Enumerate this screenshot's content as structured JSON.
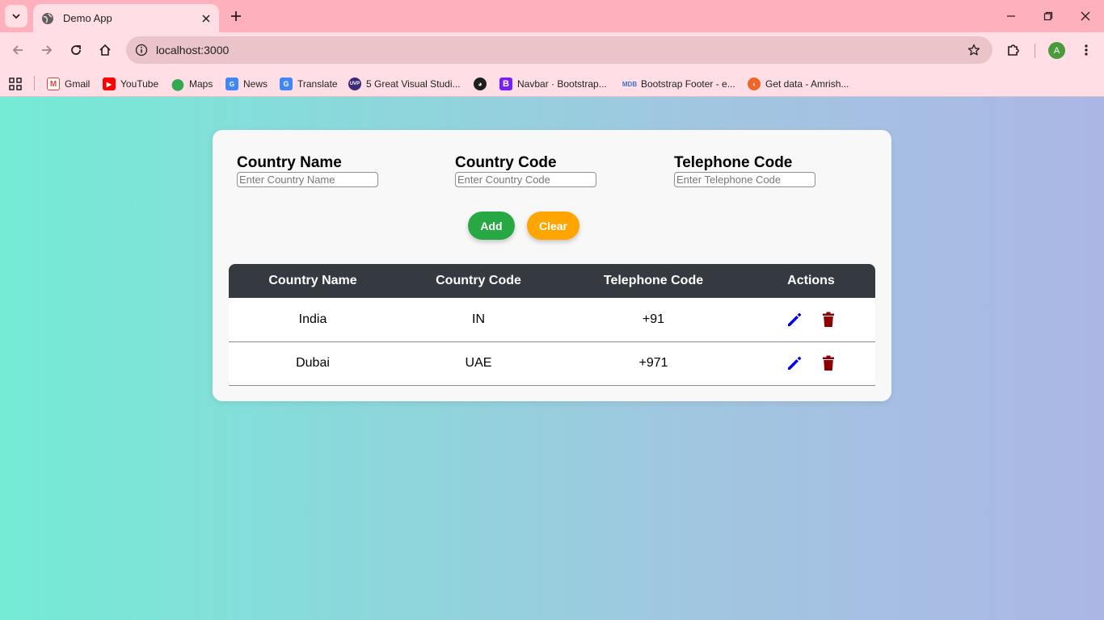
{
  "browser": {
    "tab_title": "Demo App",
    "url": "localhost:3000",
    "profile_initial": "A",
    "bookmarks": [
      {
        "label": "Gmail",
        "icon": "gmail-icon"
      },
      {
        "label": "YouTube",
        "icon": "youtube-icon"
      },
      {
        "label": "Maps",
        "icon": "maps-icon"
      },
      {
        "label": "News",
        "icon": "news-icon"
      },
      {
        "label": "Translate",
        "icon": "translate-icon"
      },
      {
        "label": "5 Great Visual Studi...",
        "icon": "site-icon"
      },
      {
        "label": "",
        "icon": "globe-icon"
      },
      {
        "label": "Navbar · Bootstrap...",
        "icon": "bootstrap-icon"
      },
      {
        "label": "Bootstrap Footer - e...",
        "icon": "mdb-icon"
      },
      {
        "label": "Get data - Amrish...",
        "icon": "site-icon"
      }
    ]
  },
  "form": {
    "country_name_label": "Country Name",
    "country_name_placeholder": "Enter Country Name",
    "country_code_label": "Country Code",
    "country_code_placeholder": "Enter Country Code",
    "telephone_code_label": "Telephone Code",
    "telephone_code_placeholder": "Enter Telephone Code",
    "add_label": "Add",
    "clear_label": "Clear"
  },
  "table": {
    "headers": [
      "Country Name",
      "Country Code",
      "Telephone Code",
      "Actions"
    ],
    "rows": [
      {
        "name": "India",
        "code": "IN",
        "phone": "+91"
      },
      {
        "name": "Dubai",
        "code": "UAE",
        "phone": "+971"
      }
    ]
  },
  "colors": {
    "add_button": "#28a745",
    "clear_button": "#ffa500",
    "edit_icon": "#0000ee",
    "delete_icon": "#8b0000",
    "table_header": "#343a40"
  }
}
